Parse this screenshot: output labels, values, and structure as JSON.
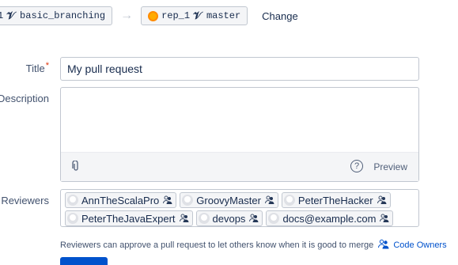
{
  "branch_selector": {
    "source_repo_fragment": "1",
    "source_branch": "basic_branching",
    "target_repo": "rep_1",
    "target_branch": "master",
    "change_label": "Change"
  },
  "form": {
    "title_label": "Title",
    "required_marker": "*",
    "title_value": "My pull request",
    "description_label": "Description",
    "description_value": "",
    "preview_label": "Preview",
    "help_glyph": "?",
    "reviewers_label": "Reviewers",
    "reviewers": [
      "AnnTheScalaPro",
      "GroovyMaster",
      "PeterTheHacker",
      "PeterTheJavaExpert",
      "devops",
      "docs@example.com"
    ],
    "hint_text": "Reviewers can approve a pull request to let others know when it is good to merge",
    "code_owners_label": "Code Owners"
  },
  "icons": {
    "branch": "branch-icon",
    "repo": "repo-icon",
    "arrow": "arrow-right-icon",
    "attach": "paperclip-icon",
    "help": "help-icon",
    "code_owner": "code-owner-icon"
  },
  "colors": {
    "link": "#0052cc",
    "required": "#de350b",
    "repo_icon": "#ffab00"
  }
}
